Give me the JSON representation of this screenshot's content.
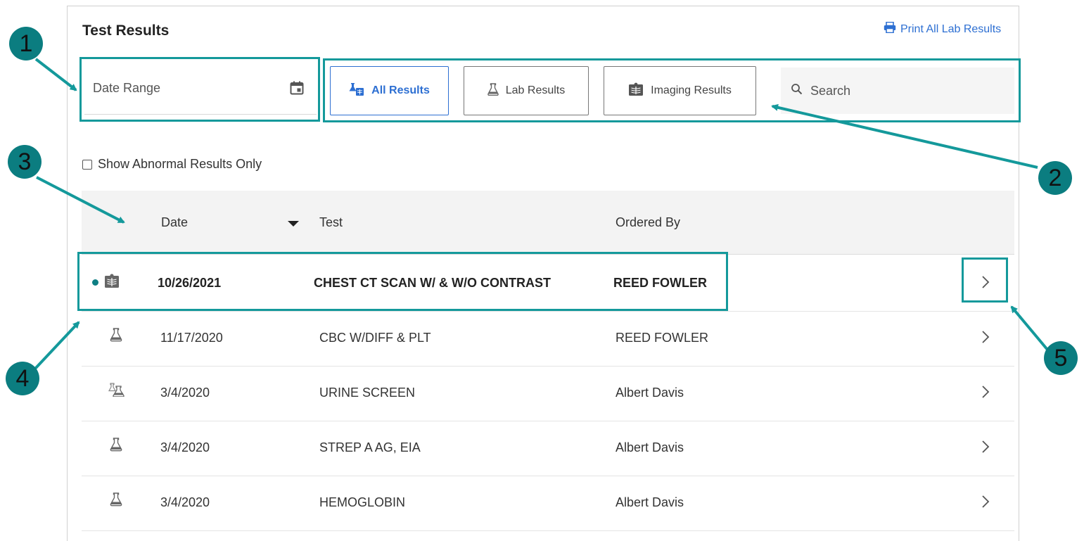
{
  "header": {
    "title": "Test Results",
    "print_link": "Print All Lab Results"
  },
  "filters": {
    "date_range_label": "Date Range",
    "buttons": [
      {
        "label": "All Results",
        "active": true,
        "icon": "flask-xray-icon"
      },
      {
        "label": "Lab Results",
        "active": false,
        "icon": "flask-icon"
      },
      {
        "label": "Imaging Results",
        "active": false,
        "icon": "xray-icon"
      }
    ],
    "search_placeholder": "Search",
    "abnormal_only_label": "Show Abnormal Results Only",
    "abnormal_only_checked": false
  },
  "table": {
    "columns": [
      "Date",
      "Test",
      "Ordered By"
    ],
    "sort_indicator": "descending",
    "rows": [
      {
        "date": "10/26/2021",
        "test": "CHEST CT SCAN W/ & W/O CONTRAST",
        "ordered_by": "REED FOWLER",
        "unread": true,
        "icon": "xray-icon"
      },
      {
        "date": "11/17/2020",
        "test": "CBC W/DIFF & PLT",
        "ordered_by": "REED FOWLER",
        "unread": false,
        "icon": "flask-icon"
      },
      {
        "date": "3/4/2020",
        "test": "URINE SCREEN",
        "ordered_by": "Albert Davis",
        "unread": false,
        "icon": "double-flask-icon"
      },
      {
        "date": "3/4/2020",
        "test": "STREP A AG, EIA",
        "ordered_by": "Albert Davis",
        "unread": false,
        "icon": "flask-icon"
      },
      {
        "date": "3/4/2020",
        "test": "HEMOGLOBIN",
        "ordered_by": "Albert Davis",
        "unread": false,
        "icon": "flask-icon"
      }
    ]
  },
  "callouts": [
    "1",
    "2",
    "3",
    "4",
    "5"
  ],
  "colors": {
    "accent": "#2d6fd2",
    "callout": "#14999b",
    "badge": "#0b7d80",
    "unread_dot": "#0e7f84"
  }
}
